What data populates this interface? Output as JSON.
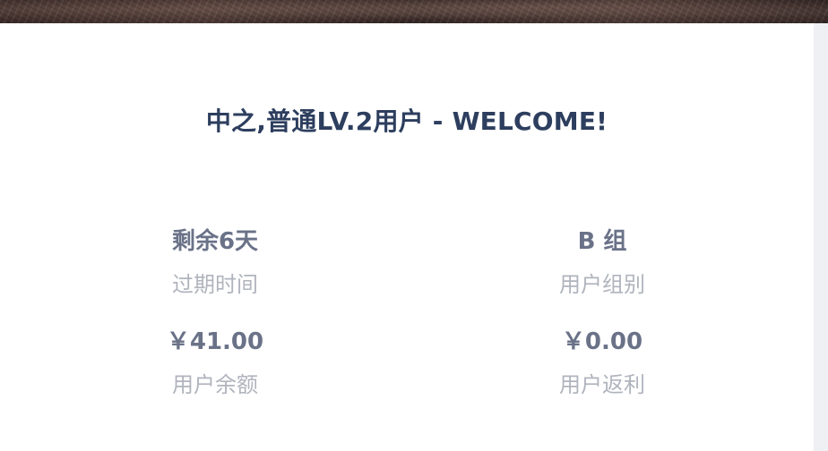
{
  "welcome": {
    "title": "中之,普通LV.2用户 - WELCOME!"
  },
  "stats": {
    "expire": {
      "value": "剩余6天",
      "label": "过期时间"
    },
    "group": {
      "value": "B 组",
      "label": "用户组别"
    },
    "balance": {
      "value": "￥41.00",
      "label": "用户余额"
    },
    "rebate": {
      "value": "￥0.00",
      "label": "用户返利"
    }
  },
  "colors": {
    "title": "#2d3e5e",
    "value": "#6a7288",
    "label": "#b0b4bd"
  }
}
